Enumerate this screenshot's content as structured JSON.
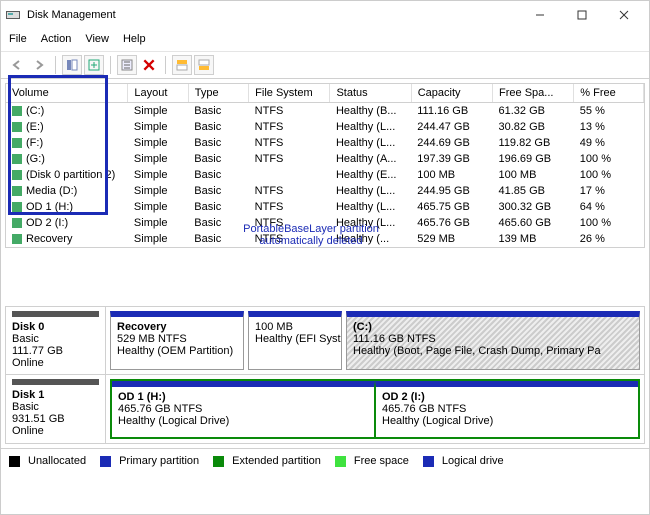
{
  "window": {
    "title": "Disk Management"
  },
  "menu": {
    "items": [
      "File",
      "Action",
      "View",
      "Help"
    ]
  },
  "toolbar": {
    "buttons": [
      "back-icon",
      "forward-icon",
      "sep",
      "show-hide-icon",
      "refresh-icon",
      "sep",
      "settings-icon",
      "delete-icon",
      "sep",
      "view-top-icon",
      "view-bottom-icon"
    ]
  },
  "volumes": {
    "columns": [
      "Volume",
      "Layout",
      "Type",
      "File System",
      "Status",
      "Capacity",
      "Free Spa...",
      "% Free"
    ],
    "rows": [
      {
        "volume": "(C:)",
        "layout": "Simple",
        "type": "Basic",
        "fs": "NTFS",
        "status": "Healthy (B...",
        "capacity": "111.16 GB",
        "free": "61.32 GB",
        "pct": "55 %"
      },
      {
        "volume": "(E:)",
        "layout": "Simple",
        "type": "Basic",
        "fs": "NTFS",
        "status": "Healthy (L...",
        "capacity": "244.47 GB",
        "free": "30.82 GB",
        "pct": "13 %"
      },
      {
        "volume": "(F:)",
        "layout": "Simple",
        "type": "Basic",
        "fs": "NTFS",
        "status": "Healthy (L...",
        "capacity": "244.69 GB",
        "free": "119.82 GB",
        "pct": "49 %"
      },
      {
        "volume": "(G:)",
        "layout": "Simple",
        "type": "Basic",
        "fs": "NTFS",
        "status": "Healthy (A...",
        "capacity": "197.39 GB",
        "free": "196.69 GB",
        "pct": "100 %"
      },
      {
        "volume": "(Disk 0 partition 2)",
        "layout": "Simple",
        "type": "Basic",
        "fs": "",
        "status": "Healthy (E...",
        "capacity": "100 MB",
        "free": "100 MB",
        "pct": "100 %"
      },
      {
        "volume": "Media (D:)",
        "layout": "Simple",
        "type": "Basic",
        "fs": "NTFS",
        "status": "Healthy (L...",
        "capacity": "244.95 GB",
        "free": "41.85 GB",
        "pct": "17 %"
      },
      {
        "volume": "OD 1 (H:)",
        "layout": "Simple",
        "type": "Basic",
        "fs": "NTFS",
        "status": "Healthy (L...",
        "capacity": "465.75 GB",
        "free": "300.32 GB",
        "pct": "64 %"
      },
      {
        "volume": "OD 2 (I:)",
        "layout": "Simple",
        "type": "Basic",
        "fs": "NTFS",
        "status": "Healthy (L...",
        "capacity": "465.76 GB",
        "free": "465.60 GB",
        "pct": "100 %"
      },
      {
        "volume": "Recovery",
        "layout": "Simple",
        "type": "Basic",
        "fs": "NTFS",
        "status": "Healthy (...",
        "capacity": "529 MB",
        "free": "139 MB",
        "pct": "26 %"
      }
    ]
  },
  "annotation": {
    "line1": "PortableBaseLayer partition",
    "line2": "automatically deleted"
  },
  "disks": [
    {
      "name": "Disk 0",
      "type": "Basic",
      "size": "111.77 GB",
      "status": "Online",
      "partitions": [
        {
          "name": "Recovery",
          "line2": "529 MB NTFS",
          "line3": "Healthy (OEM Partition)",
          "style": "plain"
        },
        {
          "name": "",
          "line2": "100 MB",
          "line3": "Healthy (EFI Syste",
          "style": "plain"
        },
        {
          "name": "(C:)",
          "line2": "111.16 GB NTFS",
          "line3": "Healthy (Boot, Page File, Crash Dump, Primary Pa",
          "style": "hatched"
        }
      ]
    },
    {
      "name": "Disk 1",
      "type": "Basic",
      "size": "931.51 GB",
      "status": "Online",
      "wrapped": true,
      "partitions": [
        {
          "name": "OD 1  (H:)",
          "line2": "465.76 GB NTFS",
          "line3": "Healthy (Logical Drive)",
          "style": "plain"
        },
        {
          "name": "OD 2  (I:)",
          "line2": "465.76 GB NTFS",
          "line3": "Healthy (Logical Drive)",
          "style": "plain"
        }
      ]
    }
  ],
  "legend": [
    {
      "color": "#000000",
      "label": "Unallocated"
    },
    {
      "color": "#1b2bb5",
      "label": "Primary partition"
    },
    {
      "color": "#0a8a0a",
      "label": "Extended partition"
    },
    {
      "color": "#3fe23f",
      "label": "Free space"
    },
    {
      "color": "#1b2bb5",
      "label": "Logical drive"
    }
  ]
}
